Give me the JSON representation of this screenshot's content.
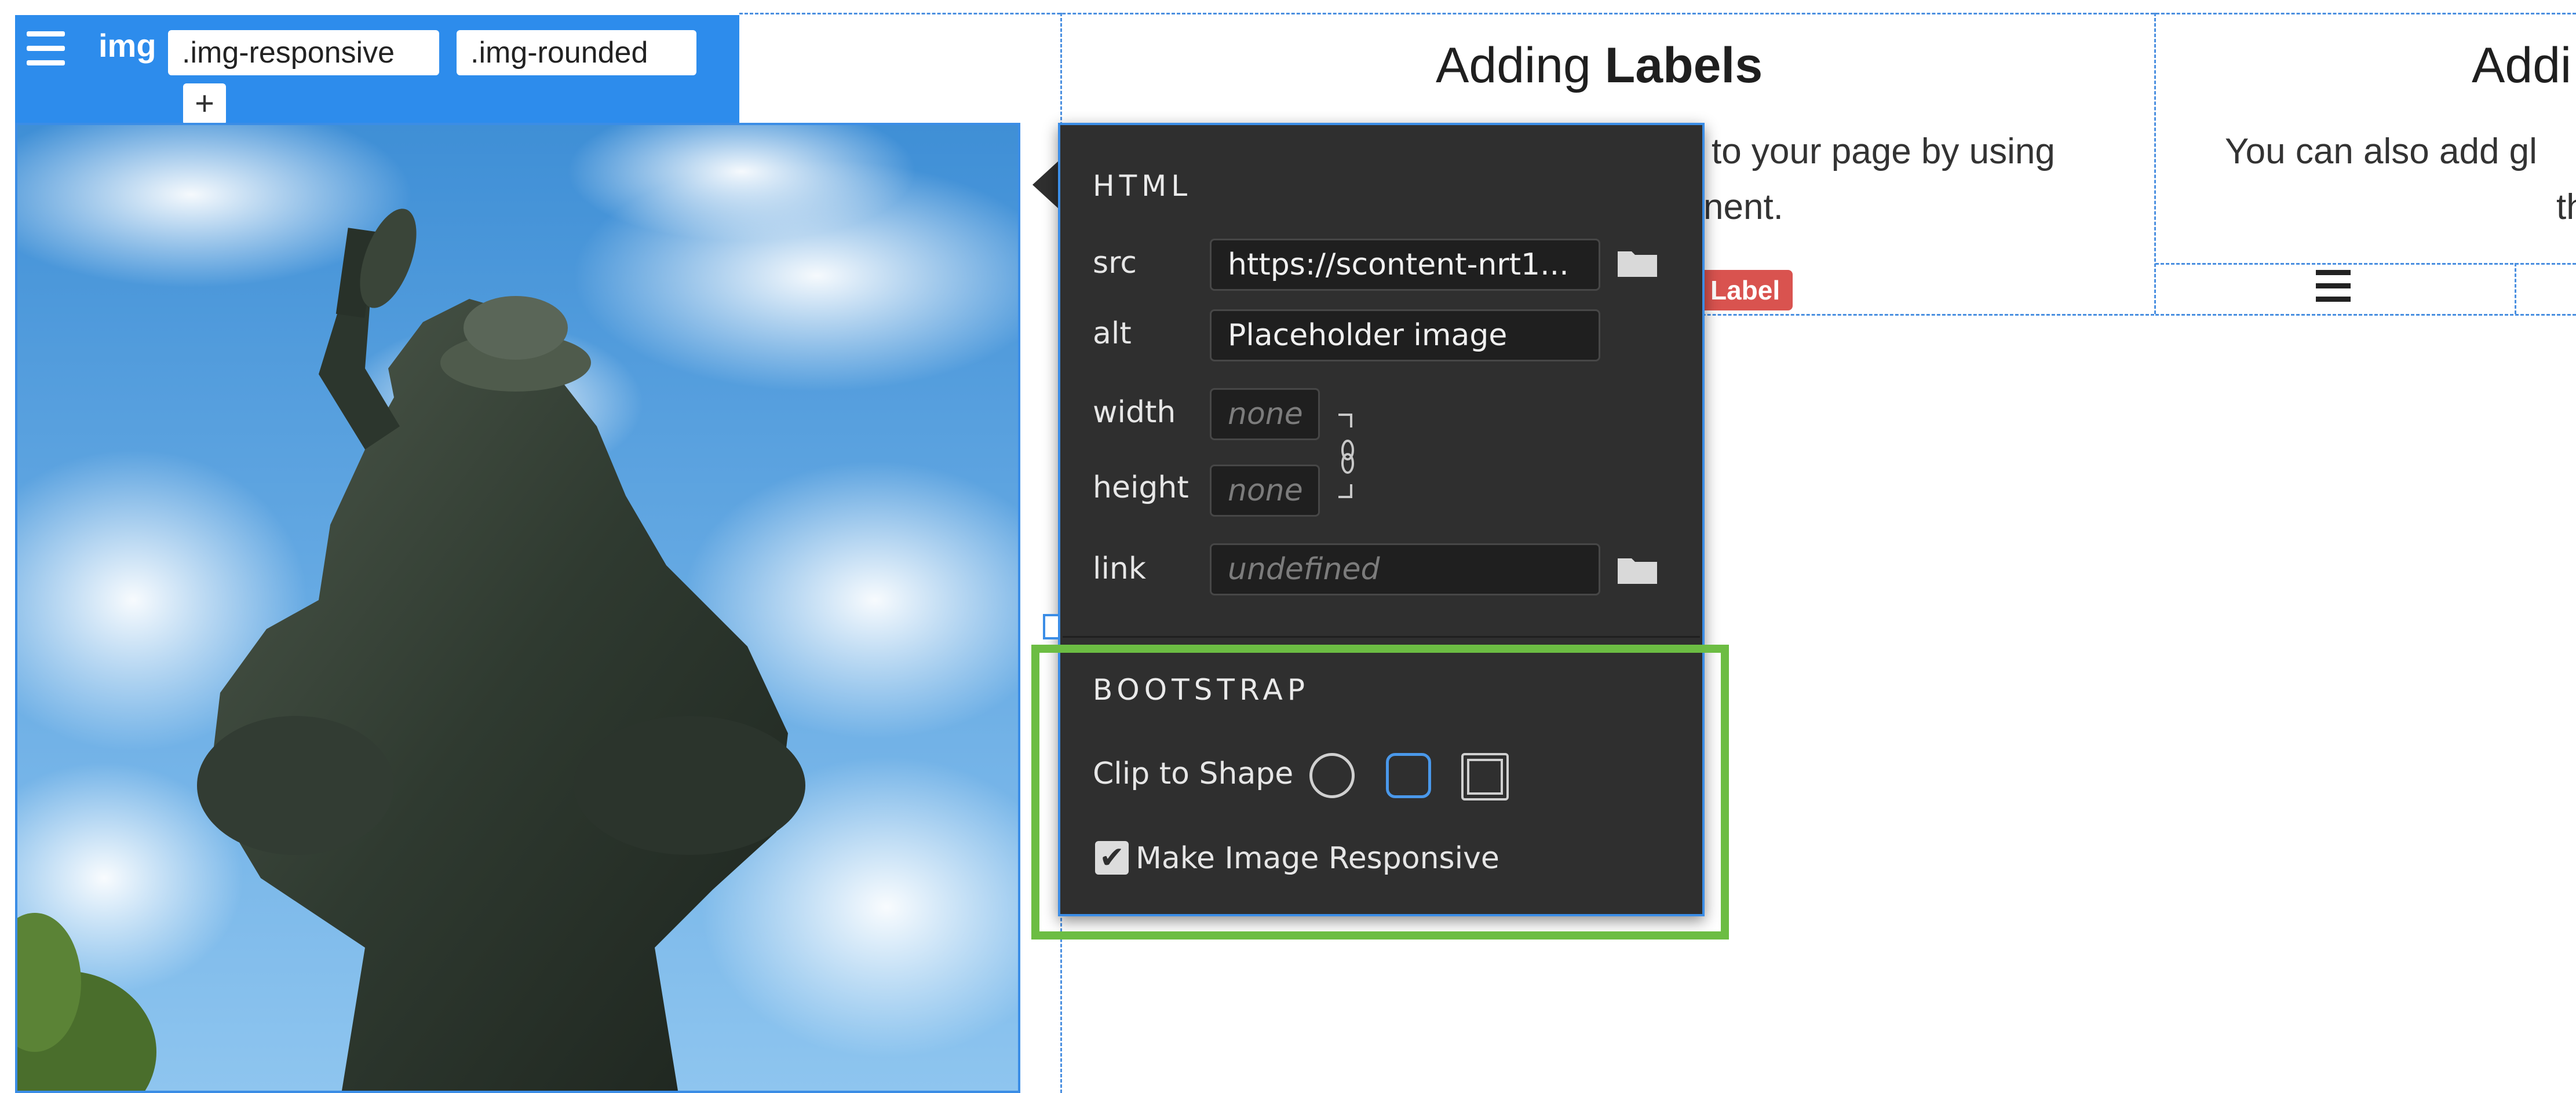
{
  "toolbar": {
    "tag": "img",
    "classes": [
      ".img-responsive",
      ".img-rounded"
    ],
    "add": "+"
  },
  "columns": {
    "first": {
      "title_plain": "Adding",
      "title_bold": "Labels",
      "line1": "to your page by using",
      "line2": "nent.",
      "badge": "Label"
    },
    "second": {
      "title": "Addi",
      "line1": "You can also add gl",
      "line2": "th",
      "nav_icon": "hamburger-icon"
    }
  },
  "panel": {
    "html_heading": "HTML",
    "fields": {
      "src": {
        "label": "src",
        "value": "https://scontent-nrt1..."
      },
      "alt": {
        "label": "alt",
        "value": "Placeholder image"
      },
      "width": {
        "label": "width",
        "placeholder": "none"
      },
      "height": {
        "label": "height",
        "placeholder": "none"
      },
      "link": {
        "label": "link",
        "placeholder": "undefined"
      }
    },
    "bootstrap_heading": "BOOTSTRAP",
    "clip_label": "Clip to Shape",
    "clip_options": [
      "circle",
      "rounded",
      "thumbnail"
    ],
    "clip_selected": "rounded",
    "responsive": {
      "label": "Make Image Responsive",
      "checked": true
    }
  },
  "colors": {
    "accent": "#2d8cec",
    "highlight": "#6cbd43",
    "label": "#d9534f",
    "panel": "#2f2f2f"
  }
}
